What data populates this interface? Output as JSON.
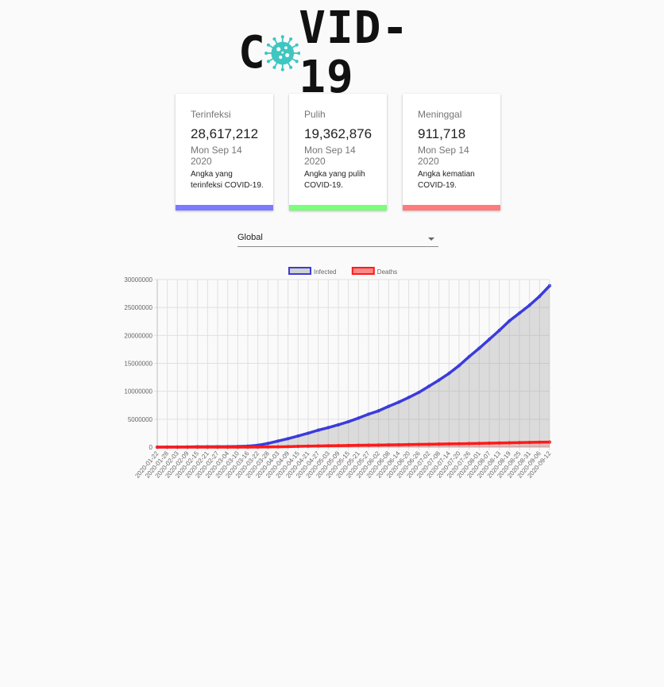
{
  "logo": {
    "text_before": "C",
    "text_after": "VID-19",
    "virus_icon": "virus-icon",
    "virus_color": "#3ec6c0"
  },
  "cards": [
    {
      "title": "Terinfeksi",
      "value": "28,617,212",
      "date": "Mon Sep 14 2020",
      "description": "Angka yang terinfeksi COVID-19.",
      "color": "#7b7bff"
    },
    {
      "title": "Pulih",
      "value": "19,362,876",
      "date": "Mon Sep 14 2020",
      "description": "Angka yang pulih COVID-19.",
      "color": "#7bff7b"
    },
    {
      "title": "Meninggal",
      "value": "911,718",
      "date": "Mon Sep 14 2020",
      "description": "Angka kematian COVID-19.",
      "color": "#ff7b7b"
    }
  ],
  "region_select": {
    "value": "Global",
    "icon": "chevron-down-icon"
  },
  "chart_data": {
    "type": "line",
    "title": "",
    "xlabel": "",
    "ylabel": "",
    "ylim": [
      0,
      30000000
    ],
    "y_ticks": [
      "0",
      "5000000",
      "10000000",
      "15000000",
      "20000000",
      "25000000",
      "30000000"
    ],
    "x_tick_labels": [
      "2020-01-22",
      "2020-01-28",
      "2020-02-03",
      "2020-02-09",
      "2020-02-15",
      "2020-02-21",
      "2020-02-27",
      "2020-03-04",
      "2020-03-10",
      "2020-03-16",
      "2020-03-22",
      "2020-03-28",
      "2020-04-03",
      "2020-04-09",
      "2020-04-15",
      "2020-04-21",
      "2020-04-27",
      "2020-05-03",
      "2020-05-09",
      "2020-05-15",
      "2020-05-21",
      "2020-05-27",
      "2020-06-02",
      "2020-06-08",
      "2020-06-14",
      "2020-06-20",
      "2020-06-26",
      "2020-07-02",
      "2020-07-08",
      "2020-07-14",
      "2020-07-20",
      "2020-07-26",
      "2020-08-01",
      "2020-08-07",
      "2020-08-13",
      "2020-08-19",
      "2020-08-25",
      "2020-08-31",
      "2020-09-06",
      "2020-09-12"
    ],
    "legend_position": "top",
    "grid": true,
    "series": [
      {
        "name": "Infected",
        "color": "#3b3bdc",
        "fill": "rgba(160,160,160,0.35)",
        "values": [
          555,
          14000,
          20600,
          40000,
          69000,
          76800,
          83000,
          95000,
          118000,
          182000,
          336000,
          665000,
          1095000,
          1520000,
          2000000,
          2500000,
          3040000,
          3500000,
          4000000,
          4560000,
          5200000,
          5900000,
          6500000,
          7300000,
          8050000,
          8900000,
          9800000,
          10900000,
          12000000,
          13200000,
          14600000,
          16200000,
          17700000,
          19300000,
          20900000,
          22600000,
          24000000,
          25400000,
          27000000,
          28900000
        ]
      },
      {
        "name": "Deaths",
        "color": "#ff1a1a",
        "fill": "rgba(255,0,0,0.15)",
        "values": [
          17,
          132,
          425,
          906,
          1524,
          2250,
          2800,
          3200,
          4300,
          7200,
          14700,
          34000,
          60000,
          95000,
          138000,
          178000,
          211000,
          245000,
          275000,
          303000,
          330000,
          355000,
          380000,
          405000,
          430000,
          460000,
          490000,
          520000,
          550000,
          580000,
          610000,
          640000,
          680000,
          715000,
          750000,
          785000,
          815000,
          845000,
          880000,
          915000
        ]
      }
    ]
  }
}
